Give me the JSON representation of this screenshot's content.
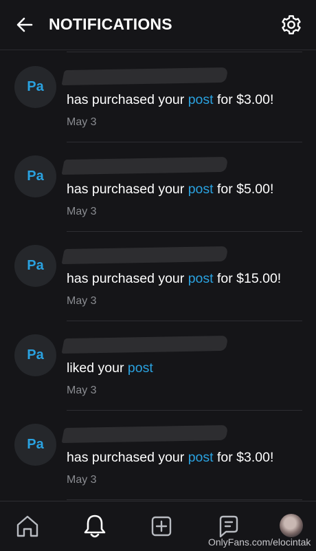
{
  "header": {
    "title": "NOTIFICATIONS",
    "back_icon": "arrow-left-icon",
    "settings_icon": "gear-icon"
  },
  "colors": {
    "background": "#151518",
    "accent": "#2aa2e0",
    "muted": "#8a8c91",
    "avatar_bg": "#25272b"
  },
  "notifications": [
    {
      "avatar": "Pa",
      "text_before": "has purchased your",
      "link": "post",
      "text_after": "for $3.00!",
      "date": "May 3"
    },
    {
      "avatar": "Pa",
      "text_before": "has purchased your",
      "link": "post",
      "text_after": "for $5.00!",
      "date": "May 3"
    },
    {
      "avatar": "Pa",
      "text_before": "has purchased your",
      "link": "post",
      "text_after": "for $15.00!",
      "date": "May 3"
    },
    {
      "avatar": "Pa",
      "text_before": "liked your",
      "link": "post",
      "text_after": "",
      "date": "May 3"
    },
    {
      "avatar": "Pa",
      "text_before": "has purchased your",
      "link": "post",
      "text_after": "for $3.00!",
      "date": "May 3"
    }
  ],
  "bottom_nav": {
    "items": [
      "home-icon",
      "bell-icon",
      "add-post-icon",
      "messages-icon",
      "profile-avatar"
    ],
    "active": "bell-icon"
  },
  "watermark": "OnlyFans.com/elocintak"
}
